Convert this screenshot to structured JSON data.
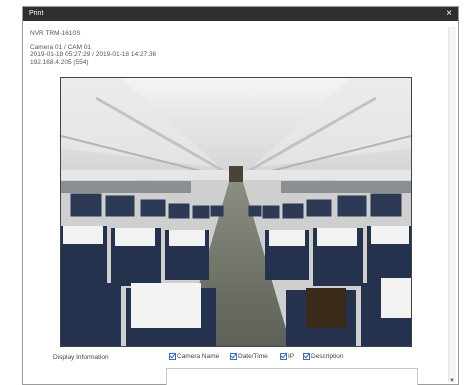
{
  "window": {
    "title": "Print"
  },
  "info": {
    "device": "NVR TRM-1610S",
    "camera": "Camera 01 / CAM 01",
    "datetime": "2019-01-18 05:27:29 / 2019-01-18 14:27:36",
    "address": "192.168.4.205 (554)"
  },
  "display_options": {
    "label": "Display Information",
    "camera_name": "Camera Name",
    "date_time": "Date/Time",
    "ip": "IP",
    "description": "Description"
  },
  "description_value": "",
  "icons": {
    "close": "close-icon",
    "scroll_down": "chevron-down-icon"
  }
}
